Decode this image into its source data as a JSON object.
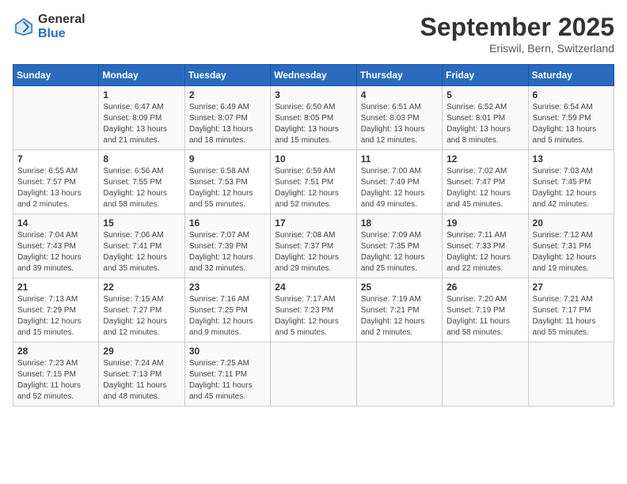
{
  "header": {
    "logo_general": "General",
    "logo_blue": "Blue",
    "month_title": "September 2025",
    "location": "Eriswil, Bern, Switzerland"
  },
  "days_of_week": [
    "Sunday",
    "Monday",
    "Tuesday",
    "Wednesday",
    "Thursday",
    "Friday",
    "Saturday"
  ],
  "weeks": [
    [
      {
        "day": "",
        "info": ""
      },
      {
        "day": "1",
        "info": "Sunrise: 6:47 AM\nSunset: 8:09 PM\nDaylight: 13 hours\nand 21 minutes."
      },
      {
        "day": "2",
        "info": "Sunrise: 6:49 AM\nSunset: 8:07 PM\nDaylight: 13 hours\nand 18 minutes."
      },
      {
        "day": "3",
        "info": "Sunrise: 6:50 AM\nSunset: 8:05 PM\nDaylight: 13 hours\nand 15 minutes."
      },
      {
        "day": "4",
        "info": "Sunrise: 6:51 AM\nSunset: 8:03 PM\nDaylight: 13 hours\nand 12 minutes."
      },
      {
        "day": "5",
        "info": "Sunrise: 6:52 AM\nSunset: 8:01 PM\nDaylight: 13 hours\nand 8 minutes."
      },
      {
        "day": "6",
        "info": "Sunrise: 6:54 AM\nSunset: 7:59 PM\nDaylight: 13 hours\nand 5 minutes."
      }
    ],
    [
      {
        "day": "7",
        "info": "Sunrise: 6:55 AM\nSunset: 7:57 PM\nDaylight: 13 hours\nand 2 minutes."
      },
      {
        "day": "8",
        "info": "Sunrise: 6:56 AM\nSunset: 7:55 PM\nDaylight: 12 hours\nand 58 minutes."
      },
      {
        "day": "9",
        "info": "Sunrise: 6:58 AM\nSunset: 7:53 PM\nDaylight: 12 hours\nand 55 minutes."
      },
      {
        "day": "10",
        "info": "Sunrise: 6:59 AM\nSunset: 7:51 PM\nDaylight: 12 hours\nand 52 minutes."
      },
      {
        "day": "11",
        "info": "Sunrise: 7:00 AM\nSunset: 7:49 PM\nDaylight: 12 hours\nand 49 minutes."
      },
      {
        "day": "12",
        "info": "Sunrise: 7:02 AM\nSunset: 7:47 PM\nDaylight: 12 hours\nand 45 minutes."
      },
      {
        "day": "13",
        "info": "Sunrise: 7:03 AM\nSunset: 7:45 PM\nDaylight: 12 hours\nand 42 minutes."
      }
    ],
    [
      {
        "day": "14",
        "info": "Sunrise: 7:04 AM\nSunset: 7:43 PM\nDaylight: 12 hours\nand 39 minutes."
      },
      {
        "day": "15",
        "info": "Sunrise: 7:06 AM\nSunset: 7:41 PM\nDaylight: 12 hours\nand 35 minutes."
      },
      {
        "day": "16",
        "info": "Sunrise: 7:07 AM\nSunset: 7:39 PM\nDaylight: 12 hours\nand 32 minutes."
      },
      {
        "day": "17",
        "info": "Sunrise: 7:08 AM\nSunset: 7:37 PM\nDaylight: 12 hours\nand 29 minutes."
      },
      {
        "day": "18",
        "info": "Sunrise: 7:09 AM\nSunset: 7:35 PM\nDaylight: 12 hours\nand 25 minutes."
      },
      {
        "day": "19",
        "info": "Sunrise: 7:11 AM\nSunset: 7:33 PM\nDaylight: 12 hours\nand 22 minutes."
      },
      {
        "day": "20",
        "info": "Sunrise: 7:12 AM\nSunset: 7:31 PM\nDaylight: 12 hours\nand 19 minutes."
      }
    ],
    [
      {
        "day": "21",
        "info": "Sunrise: 7:13 AM\nSunset: 7:29 PM\nDaylight: 12 hours\nand 15 minutes."
      },
      {
        "day": "22",
        "info": "Sunrise: 7:15 AM\nSunset: 7:27 PM\nDaylight: 12 hours\nand 12 minutes."
      },
      {
        "day": "23",
        "info": "Sunrise: 7:16 AM\nSunset: 7:25 PM\nDaylight: 12 hours\nand 9 minutes."
      },
      {
        "day": "24",
        "info": "Sunrise: 7:17 AM\nSunset: 7:23 PM\nDaylight: 12 hours\nand 5 minutes."
      },
      {
        "day": "25",
        "info": "Sunrise: 7:19 AM\nSunset: 7:21 PM\nDaylight: 12 hours\nand 2 minutes."
      },
      {
        "day": "26",
        "info": "Sunrise: 7:20 AM\nSunset: 7:19 PM\nDaylight: 11 hours\nand 58 minutes."
      },
      {
        "day": "27",
        "info": "Sunrise: 7:21 AM\nSunset: 7:17 PM\nDaylight: 11 hours\nand 55 minutes."
      }
    ],
    [
      {
        "day": "28",
        "info": "Sunrise: 7:23 AM\nSunset: 7:15 PM\nDaylight: 11 hours\nand 52 minutes."
      },
      {
        "day": "29",
        "info": "Sunrise: 7:24 AM\nSunset: 7:13 PM\nDaylight: 11 hours\nand 48 minutes."
      },
      {
        "day": "30",
        "info": "Sunrise: 7:25 AM\nSunset: 7:11 PM\nDaylight: 11 hours\nand 45 minutes."
      },
      {
        "day": "",
        "info": ""
      },
      {
        "day": "",
        "info": ""
      },
      {
        "day": "",
        "info": ""
      },
      {
        "day": "",
        "info": ""
      }
    ]
  ]
}
